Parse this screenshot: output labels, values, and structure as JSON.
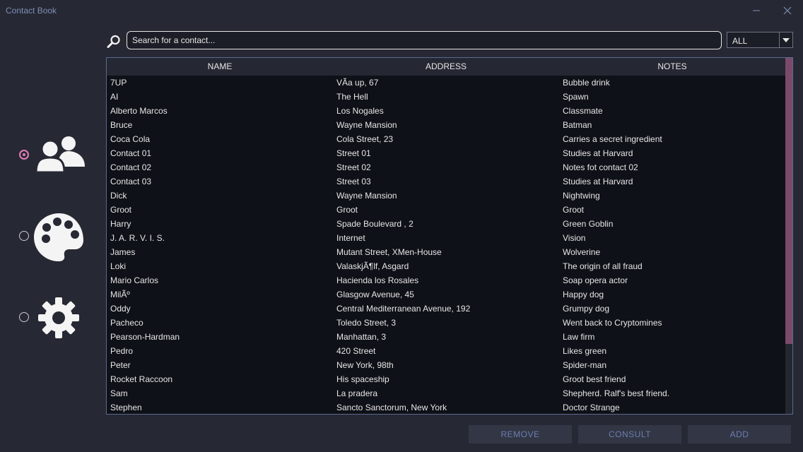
{
  "window": {
    "title": "Contact Book",
    "minimize_icon": "minimize-icon",
    "close_icon": "close-icon"
  },
  "search": {
    "icon": "search-icon",
    "placeholder": "Search for a contact...",
    "value": ""
  },
  "filter": {
    "selected": "ALL",
    "arrow_icon": "dropdown-arrow-icon"
  },
  "nav": [
    {
      "name": "contacts",
      "icon": "contacts-icon",
      "selected": true
    },
    {
      "name": "theme",
      "icon": "palette-icon",
      "selected": false
    },
    {
      "name": "settings",
      "icon": "gear-icon",
      "selected": false
    }
  ],
  "table": {
    "headers": [
      "NAME",
      "ADDRESS",
      "NOTES"
    ],
    "rows": [
      [
        "7UP",
        "VÃ­a up, 67",
        "Bubble drink"
      ],
      [
        "AI",
        "The Hell",
        "Spawn"
      ],
      [
        "Alberto Marcos",
        "Los Nogales",
        "Classmate"
      ],
      [
        "Bruce",
        "Wayne Mansion",
        "Batman"
      ],
      [
        "Coca Cola",
        "Cola Street, 23",
        "Carries a secret ingredient"
      ],
      [
        "Contact 01",
        "Street 01",
        "Studies at Harvard"
      ],
      [
        "Contact 02",
        "Street 02",
        "Notes fot contact 02"
      ],
      [
        "Contact 03",
        "Street 03",
        "Studies at Harvard"
      ],
      [
        "Dick",
        "Wayne Mansion",
        "Nightwing"
      ],
      [
        "Groot",
        "Groot",
        "Groot"
      ],
      [
        "Harry",
        "Spade Boulevard , 2",
        "Green Goblin"
      ],
      [
        "J. A. R. V. I. S.",
        "Internet",
        "Vision"
      ],
      [
        "James",
        "Mutant Street, XMen-House",
        "Wolverine"
      ],
      [
        "Loki",
        "ValaskjÃ¶lf, Asgard",
        "The origin of all fraud"
      ],
      [
        "Mario Carlos",
        "Hacienda los Rosales",
        "Soap opera actor"
      ],
      [
        "MilÃº",
        "Glasgow Avenue, 45",
        "Happy dog"
      ],
      [
        "Oddy",
        "Central Mediterranean Avenue, 192",
        "Grumpy dog"
      ],
      [
        "Pacheco",
        "Toledo Street, 3",
        "Went back to Cryptomines"
      ],
      [
        "Pearson-Hardman",
        "Manhattan, 3",
        "Law firm"
      ],
      [
        "Pedro",
        "420 Street",
        "Likes green"
      ],
      [
        "Peter",
        "New York, 98th",
        "Spider-man"
      ],
      [
        "Rocket Raccoon",
        "His spaceship",
        "Groot best friend"
      ],
      [
        "Sam",
        "La pradera",
        "Shepherd. Ralf's best friend."
      ],
      [
        "Stephen",
        "Sancto Sanctorum, New York",
        "Doctor Strange"
      ]
    ]
  },
  "buttons": {
    "remove": "REMOVE",
    "consult": "CONSULT",
    "add": "ADD"
  },
  "colors": {
    "background": "#262833",
    "table_background": "#0f1118",
    "accent": "#e37eb6",
    "scrollbar_thumb": "#7b4a6b",
    "disabled_text": "#6b7fae"
  }
}
